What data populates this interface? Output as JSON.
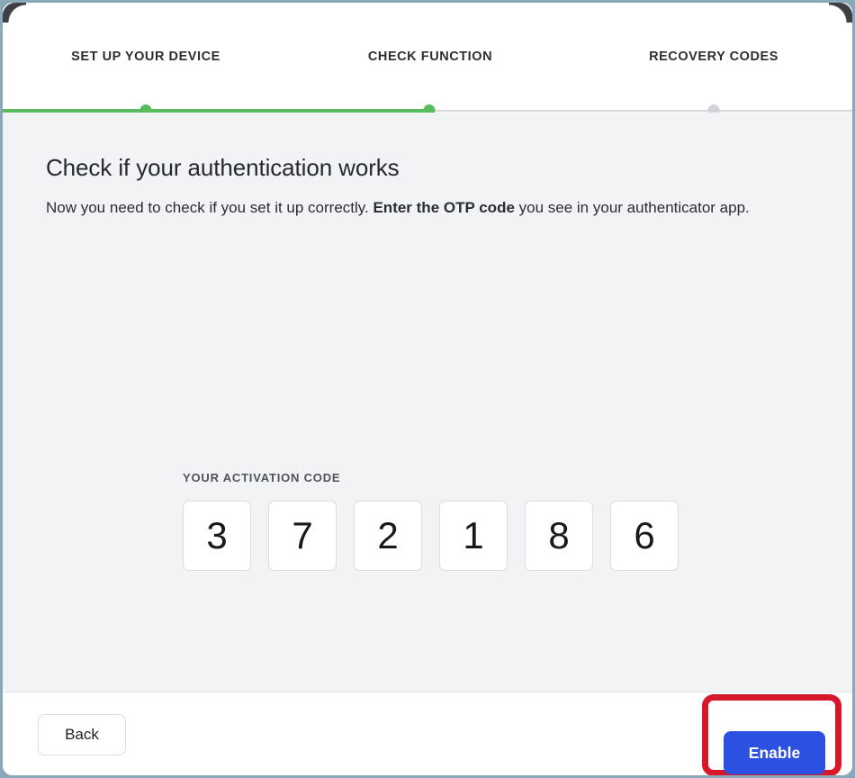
{
  "window": {
    "frame_color": "#8ba8b8"
  },
  "stepper": {
    "steps": [
      {
        "label": "SET UP YOUR DEVICE",
        "state": "done"
      },
      {
        "label": "CHECK FUNCTION",
        "state": "done"
      },
      {
        "label": "RECOVERY CODES",
        "state": "todo"
      }
    ],
    "active_color": "#59bd5d",
    "inactive_color": "#d2d3d6"
  },
  "main": {
    "title": "Check if your authentication works",
    "description_part1": "Now you need to check if you set it up correctly. ",
    "description_strong": "Enter the OTP code",
    "description_part2": " you see in your authenticator app.",
    "otp": {
      "label": "YOUR ACTIVATION CODE",
      "digits": [
        "3",
        "7",
        "2",
        "1",
        "8",
        "6"
      ],
      "value": "372186"
    }
  },
  "footer": {
    "back_label": "Back",
    "enable_label": "Enable",
    "enable_color": "#2c50e0",
    "highlight_color": "#d6182a"
  }
}
